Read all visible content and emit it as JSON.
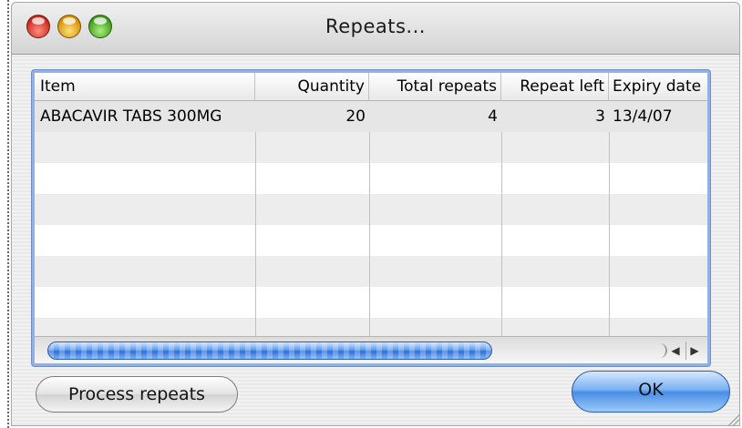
{
  "window": {
    "title": "Repeats..."
  },
  "table": {
    "columns": [
      {
        "label": "Item"
      },
      {
        "label": "Quantity"
      },
      {
        "label": "Total repeats"
      },
      {
        "label": "Repeat left"
      },
      {
        "label": "Expiry date"
      }
    ],
    "rows": [
      {
        "item": "ABACAVIR TABS 300MG",
        "quantity": "20",
        "total_repeats": "4",
        "repeat_left": "3",
        "expiry_date": "13/4/07"
      }
    ]
  },
  "buttons": {
    "process_repeats": "Process repeats",
    "ok": "OK"
  },
  "colors": {
    "default_button": "#4a8de6",
    "table_focus_ring": "#8fb1e6"
  }
}
